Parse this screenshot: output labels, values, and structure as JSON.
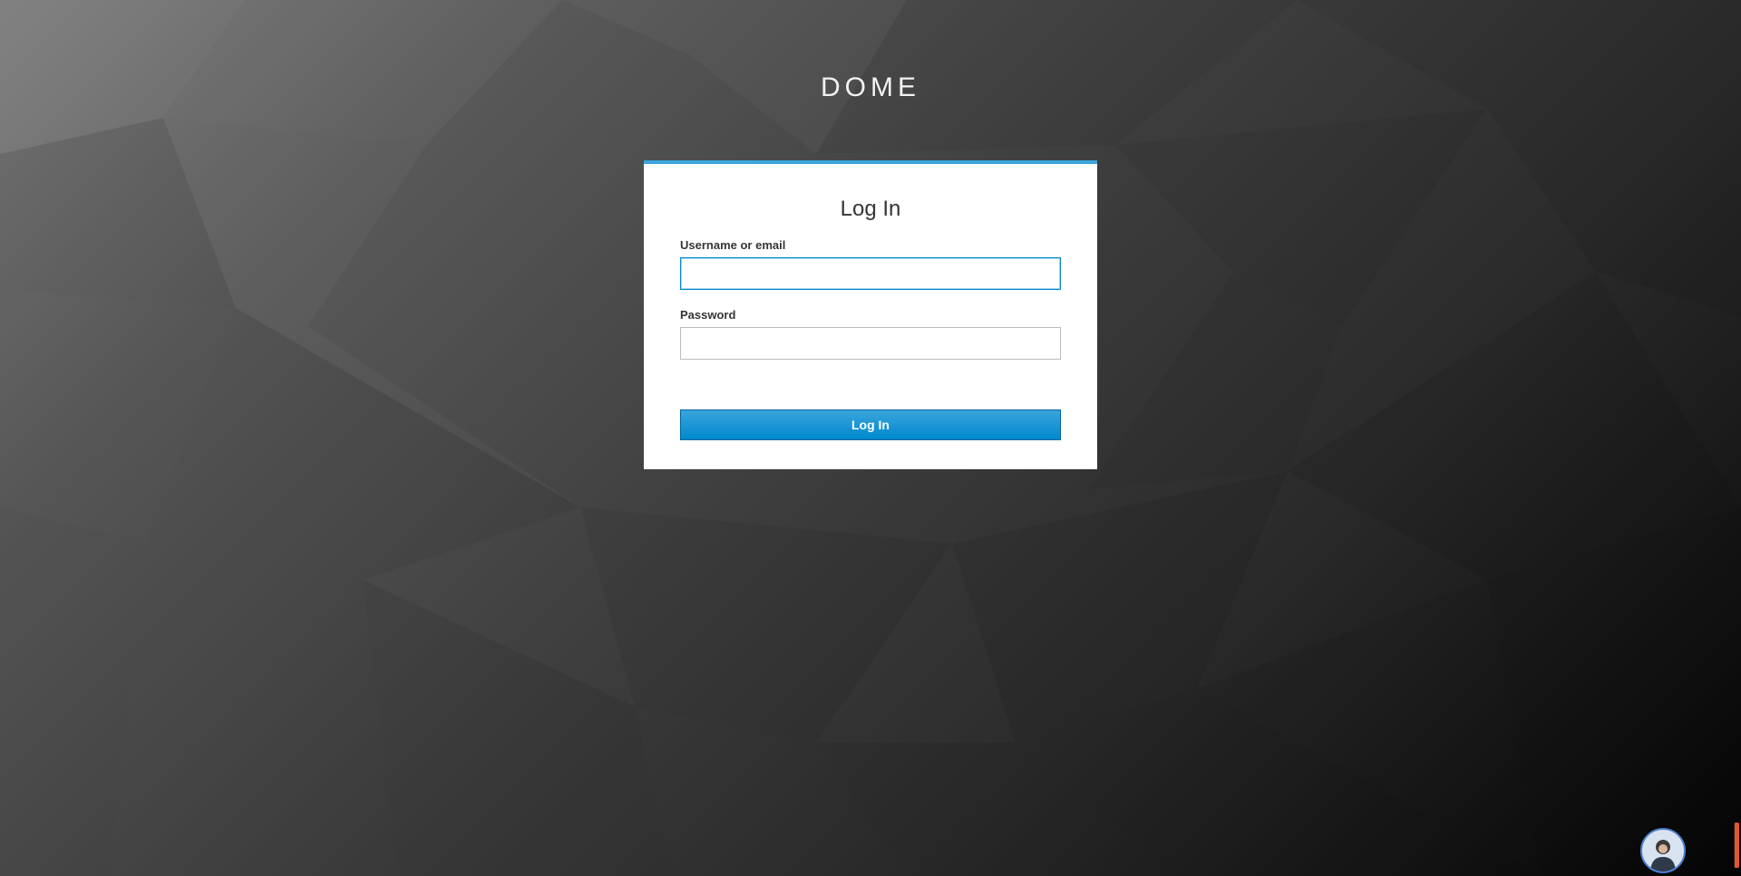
{
  "brand": {
    "title": "DOME"
  },
  "login": {
    "title": "Log In",
    "username": {
      "label": "Username or email",
      "value": "",
      "placeholder": ""
    },
    "password": {
      "label": "Password",
      "value": "",
      "placeholder": ""
    },
    "submit_label": "Log In"
  },
  "colors": {
    "accent": "#0088ce",
    "card_background": "#ffffff",
    "brand_text": "#f2f2f2"
  },
  "icons": {
    "avatar": "user-avatar-icon",
    "scroll": "scroll-handle"
  }
}
